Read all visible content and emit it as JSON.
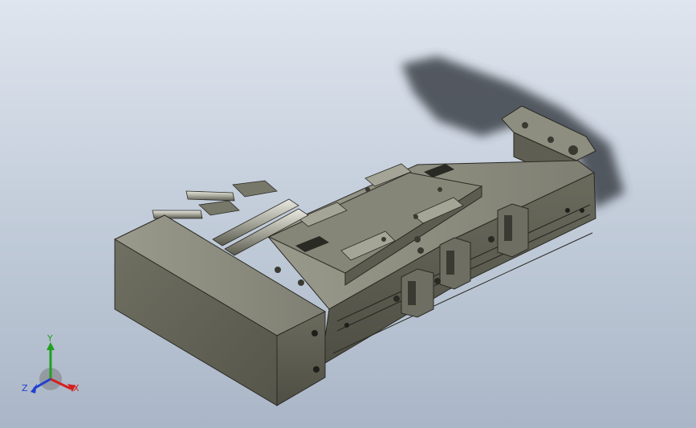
{
  "viewport": {
    "background_top": "#dfe5ee",
    "background_bottom": "#aab6c7"
  },
  "triad": {
    "x_label": "X",
    "y_label": "Y",
    "z_label": "Z",
    "x_color": "#d42020",
    "y_color": "#20a020",
    "z_color": "#2040d0"
  },
  "model": {
    "body_color": "#6b6b5e",
    "shadow_color": "#3e4248"
  }
}
